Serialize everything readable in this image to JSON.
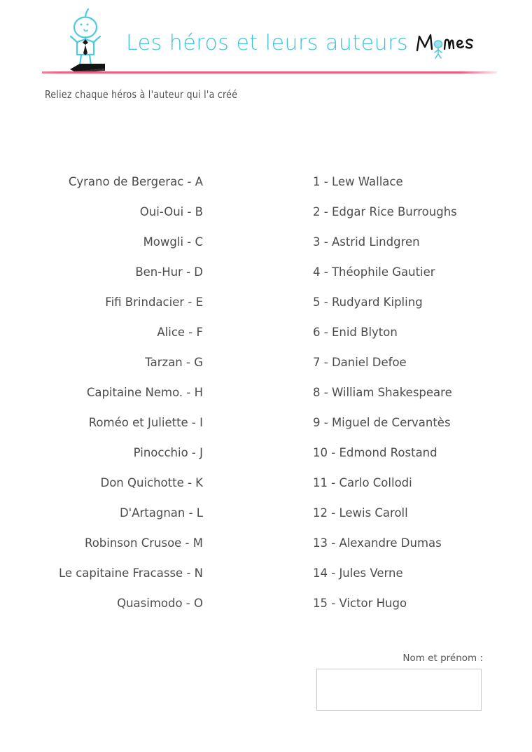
{
  "header": {
    "title": "Les héros et leurs auteurs",
    "brand_name": "Momes",
    "mascot_icon": "stick-figure-on-book-icon",
    "accent_color": "#3fc3d6",
    "divider_color": "#ef5b7b"
  },
  "instruction": {
    "text": "Reliez chaque héros à l'auteur qui l'a créé"
  },
  "heroes": [
    {
      "label": "Cyrano de Bergerac - A"
    },
    {
      "label": "Oui-Oui - B"
    },
    {
      "label": "Mowgli - C"
    },
    {
      "label": "Ben-Hur - D"
    },
    {
      "label": "Fifi Brindacier - E"
    },
    {
      "label": "Alice - F"
    },
    {
      "label": "Tarzan - G"
    },
    {
      "label": "Capitaine Nemo. - H"
    },
    {
      "label": "Roméo et Juliette - I"
    },
    {
      "label": "Pinocchio - J"
    },
    {
      "label": "Don Quichotte - K"
    },
    {
      "label": "D'Artagnan - L"
    },
    {
      "label": "Robinson Crusoe - M"
    },
    {
      "label": "Le capitaine Fracasse - N"
    },
    {
      "label": "Quasimodo - O"
    }
  ],
  "authors": [
    {
      "label": "1 - Lew Wallace"
    },
    {
      "label": "2 - Edgar Rice Burroughs"
    },
    {
      "label": "3 - Astrid Lindgren"
    },
    {
      "label": "4 - Théophile Gautier"
    },
    {
      "label": "5 - Rudyard Kipling"
    },
    {
      "label": "6 - Enid Blyton"
    },
    {
      "label": "7 - Daniel Defoe"
    },
    {
      "label": "8 - William Shakespeare"
    },
    {
      "label": "9 - Miguel de Cervantès"
    },
    {
      "label": "10 - Edmond Rostand"
    },
    {
      "label": "11 - Carlo Collodi"
    },
    {
      "label": "12 - Lewis Caroll"
    },
    {
      "label": "13 - Alexandre Dumas"
    },
    {
      "label": "14 - Jules Verne"
    },
    {
      "label": "15 - Victor Hugo"
    }
  ],
  "name_field": {
    "label": "Nom et prénom :",
    "value": "",
    "placeholder": ""
  }
}
